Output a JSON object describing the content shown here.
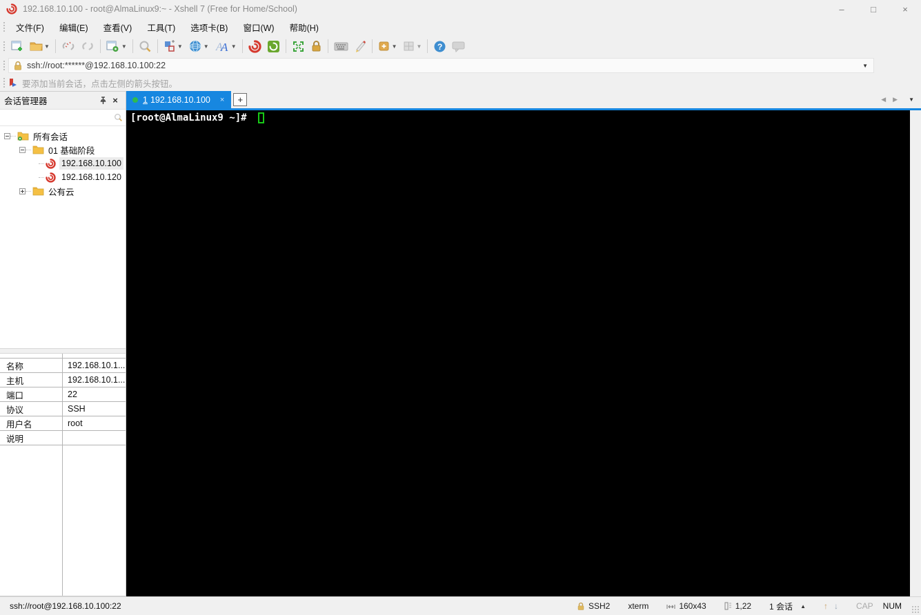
{
  "colors": {
    "accent_blue": "#1787e0",
    "tab_green_dot": "#2fbb4f",
    "terminal_green_cursor": "#17c917",
    "xshell_red": "#d63a2f",
    "folder_amber": "#f5c044",
    "lock_gold": "#d9a63f",
    "chrome_bg": "#f0f0f0",
    "terminal_bg": "#000000"
  },
  "window": {
    "title": "192.168.10.100 - root@AlmaLinux9:~ - Xshell 7 (Free for Home/School)",
    "minimize": "–",
    "maximize": "□",
    "close": "×"
  },
  "menu": {
    "items": [
      "文件(F)",
      "编辑(E)",
      "查看(V)",
      "工具(T)",
      "选项卡(B)",
      "窗口(W)",
      "帮助(H)"
    ]
  },
  "toolbar": {
    "icons": [
      "new-session",
      "open-session",
      "disconnect",
      "reconnect",
      "session-properties",
      "find",
      "tile-windows",
      "encoding-globe",
      "font",
      "xshell",
      "xftp",
      "fullscreen",
      "lock-screen",
      "virtual-keyboard",
      "highlight-pen",
      "new-item",
      "layout-grid",
      "help",
      "message"
    ]
  },
  "address_bar": {
    "value": "ssh://root:******@192.168.10.100:22"
  },
  "info_bar": {
    "text": "要添加当前会话，点击左侧的箭头按钮。"
  },
  "tab_bar": {
    "active_tab": {
      "index": "1",
      "label": "192.168.10.100",
      "close": "×"
    },
    "new_tab": "+"
  },
  "session_manager": {
    "title": "会话管理器",
    "search_value": "",
    "tree": [
      {
        "label": "所有会话",
        "level": 0,
        "expanded": true,
        "icon": "folder-gear"
      },
      {
        "label": "01 基础阶段",
        "level": 1,
        "expanded": true,
        "icon": "folder"
      },
      {
        "label": "192.168.10.100",
        "level": 2,
        "selected": true,
        "icon": "xshell-session"
      },
      {
        "label": "192.168.10.120",
        "level": 2,
        "selected": false,
        "icon": "xshell-session"
      },
      {
        "label": "公有云",
        "level": 1,
        "expanded": false,
        "icon": "folder"
      }
    ]
  },
  "properties": {
    "rows": [
      {
        "label": "名称",
        "value": "192.168.10.1..."
      },
      {
        "label": "主机",
        "value": "192.168.10.1..."
      },
      {
        "label": "端口",
        "value": "22"
      },
      {
        "label": "协议",
        "value": "SSH"
      },
      {
        "label": "用户名",
        "value": "root"
      },
      {
        "label": "说明",
        "value": ""
      }
    ]
  },
  "terminal": {
    "prompt": "[root@AlmaLinux9 ~]#"
  },
  "status_bar": {
    "connection": "ssh://root@192.168.10.100:22",
    "protocol": "SSH2",
    "term_type": "xterm",
    "size": "160x43",
    "cursor_pos": "1,22",
    "session_count": "1 会话",
    "cap": "CAP",
    "num": "NUM"
  }
}
